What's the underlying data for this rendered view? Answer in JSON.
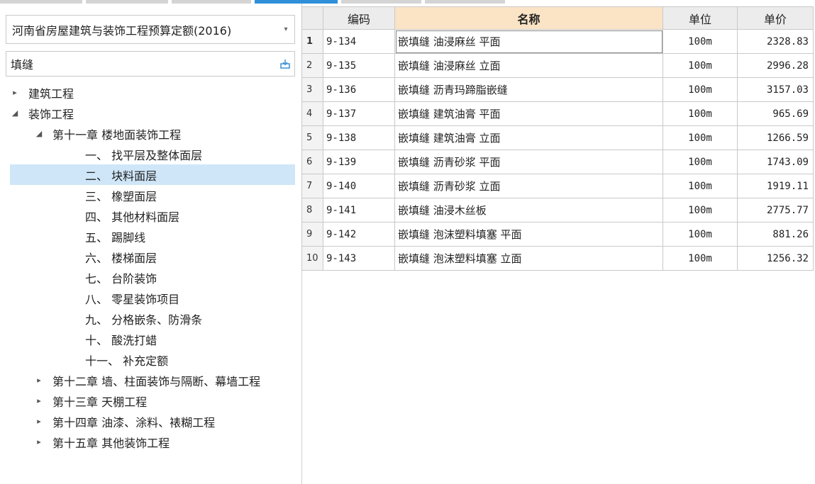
{
  "tabs_strip": [
    "tab-1",
    "tab-2",
    "tab-3",
    "tab-4",
    "tab-5",
    "tab-6"
  ],
  "quota_select": {
    "value": "河南省房屋建筑与装饰工程预算定额(2016)"
  },
  "search": {
    "value": "填缝"
  },
  "tree": [
    {
      "level": 0,
      "toggle": "▸",
      "label": "建筑工程"
    },
    {
      "level": 0,
      "toggle": "◢",
      "label": "装饰工程"
    },
    {
      "level": 1,
      "toggle": "◢",
      "label": "第十一章 楼地面装饰工程"
    },
    {
      "level": 2,
      "toggle": "",
      "label": "一、 找平层及整体面层"
    },
    {
      "level": 2,
      "toggle": "",
      "label": "二、 块料面层",
      "selected": true
    },
    {
      "level": 2,
      "toggle": "",
      "label": "三、 橡塑面层"
    },
    {
      "level": 2,
      "toggle": "",
      "label": "四、 其他材料面层"
    },
    {
      "level": 2,
      "toggle": "",
      "label": "五、 踢脚线"
    },
    {
      "level": 2,
      "toggle": "",
      "label": "六、 楼梯面层"
    },
    {
      "level": 2,
      "toggle": "",
      "label": "七、 台阶装饰"
    },
    {
      "level": 2,
      "toggle": "",
      "label": "八、 零星装饰项目"
    },
    {
      "level": 2,
      "toggle": "",
      "label": "九、 分格嵌条、防滑条"
    },
    {
      "level": 2,
      "toggle": "",
      "label": "十、 酸洗打蜡"
    },
    {
      "level": 2,
      "toggle": "",
      "label": "十一、 补充定额"
    },
    {
      "level": 1,
      "toggle": "▸",
      "label": "第十二章 墙、柱面装饰与隔断、幕墙工程"
    },
    {
      "level": 1,
      "toggle": "▸",
      "label": "第十三章 天棚工程"
    },
    {
      "level": 1,
      "toggle": "▸",
      "label": "第十四章 油漆、涂料、裱糊工程"
    },
    {
      "level": 1,
      "toggle": "▸",
      "label": "第十五章 其他装饰工程"
    }
  ],
  "table": {
    "headers": {
      "code": "编码",
      "name": "名称",
      "unit": "单位",
      "price": "单价"
    },
    "rows": [
      {
        "no": "1",
        "code": "9-134",
        "name": "嵌填缝 油浸麻丝 平面",
        "unit": "100m",
        "price": "2328.83"
      },
      {
        "no": "2",
        "code": "9-135",
        "name": "嵌填缝 油浸麻丝 立面",
        "unit": "100m",
        "price": "2996.28"
      },
      {
        "no": "3",
        "code": "9-136",
        "name": "嵌填缝 沥青玛蹄脂嵌缝",
        "unit": "100m",
        "price": "3157.03"
      },
      {
        "no": "4",
        "code": "9-137",
        "name": "嵌填缝 建筑油膏 平面",
        "unit": "100m",
        "price": "965.69"
      },
      {
        "no": "5",
        "code": "9-138",
        "name": "嵌填缝 建筑油膏 立面",
        "unit": "100m",
        "price": "1266.59"
      },
      {
        "no": "6",
        "code": "9-139",
        "name": "嵌填缝 沥青砂浆 平面",
        "unit": "100m",
        "price": "1743.09"
      },
      {
        "no": "7",
        "code": "9-140",
        "name": "嵌填缝 沥青砂浆 立面",
        "unit": "100m",
        "price": "1919.11"
      },
      {
        "no": "8",
        "code": "9-141",
        "name": "嵌填缝 油浸木丝板",
        "unit": "100m",
        "price": "2775.77"
      },
      {
        "no": "9",
        "code": "9-142",
        "name": "嵌填缝 泡沫塑料填塞 平面",
        "unit": "100m",
        "price": "881.26"
      },
      {
        "no": "10",
        "code": "9-143",
        "name": "嵌填缝 泡沫塑料填塞 立面",
        "unit": "100m",
        "price": "1256.32"
      }
    ]
  },
  "colors": {
    "accent": "#2f8fd9",
    "selected_row": "#cfe6f8",
    "name_header": "#fbe3c6"
  }
}
